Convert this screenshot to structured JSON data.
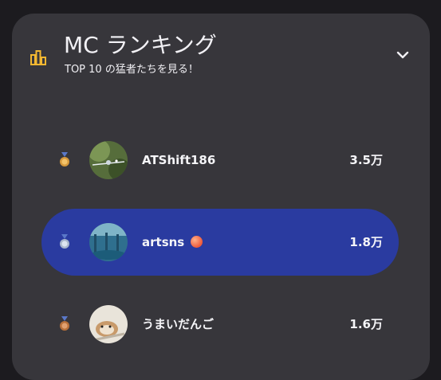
{
  "header": {
    "title": "MC ランキング",
    "subtitle": "TOP 10 の猛者たちを見る！",
    "chart_icon": "leaderboard-icon",
    "expand_icon": "chevron-down-icon"
  },
  "ranking": [
    {
      "rank": 1,
      "medal_icon": "medal-icon",
      "name": "ATShift186",
      "count": "3.5万",
      "selected": false
    },
    {
      "rank": 2,
      "medal_icon": "medal-icon",
      "name": "artsns",
      "badge_icon": "orange-ball-icon",
      "count": "1.8万",
      "selected": true
    },
    {
      "rank": 3,
      "medal_icon": "medal-icon",
      "name": "うまいだんご",
      "count": "1.6万",
      "selected": false
    }
  ],
  "colors": {
    "page_background": "#1c1b1f",
    "card_background": "#37363b",
    "selected_row": "#2a3ba0",
    "accent_icon": "#f2b731"
  }
}
